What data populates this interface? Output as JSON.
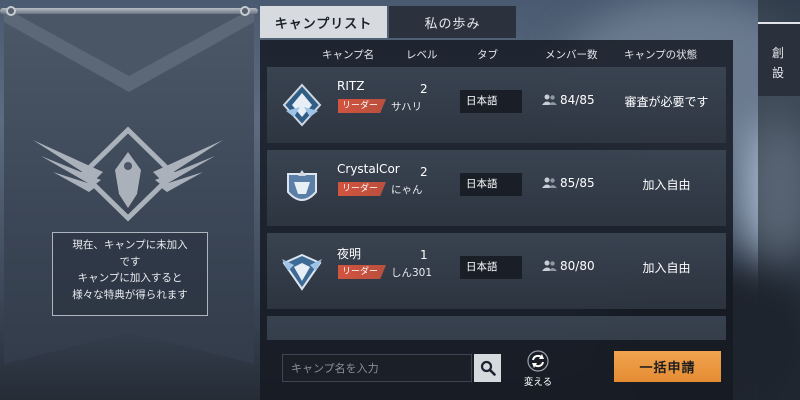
{
  "banner": {
    "notice_lines": [
      "現在、キャンプに未加入",
      "です",
      "キャンプに加入すると",
      "様々な特典が得られます"
    ]
  },
  "tabs": [
    {
      "label": "キャンプリスト",
      "active": true
    },
    {
      "label": "私の歩み",
      "active": false
    }
  ],
  "columns": {
    "name": "キャンプ名",
    "level": "レベル",
    "tab": "タブ",
    "members": "メンバー数",
    "status": "キャンプの状態"
  },
  "camps": [
    {
      "name": "RITZ",
      "leader_tag": "リーダー",
      "leader": "サハリ",
      "level": "2",
      "language": "日本語",
      "members": "84/85",
      "status": "審査が必要です"
    },
    {
      "name": "CrystalCor",
      "leader_tag": "リーダー",
      "leader": "にゃん",
      "level": "2",
      "language": "日本語",
      "members": "85/85",
      "status": "加入自由"
    },
    {
      "name": "夜明",
      "leader_tag": "リーダー",
      "leader": "しん301",
      "level": "1",
      "language": "日本語",
      "members": "80/80",
      "status": "加入自由"
    }
  ],
  "bottom": {
    "search_placeholder": "キャンプ名を入力",
    "refresh_label": "変える",
    "apply_label": "一括申請"
  },
  "side": {
    "create_chars": [
      "創",
      "設"
    ]
  },
  "colors": {
    "accent_orange": "#e99640",
    "leader_red": "#c9533f",
    "panel_dark": "#161b22",
    "tab_active": "#d7dade"
  }
}
